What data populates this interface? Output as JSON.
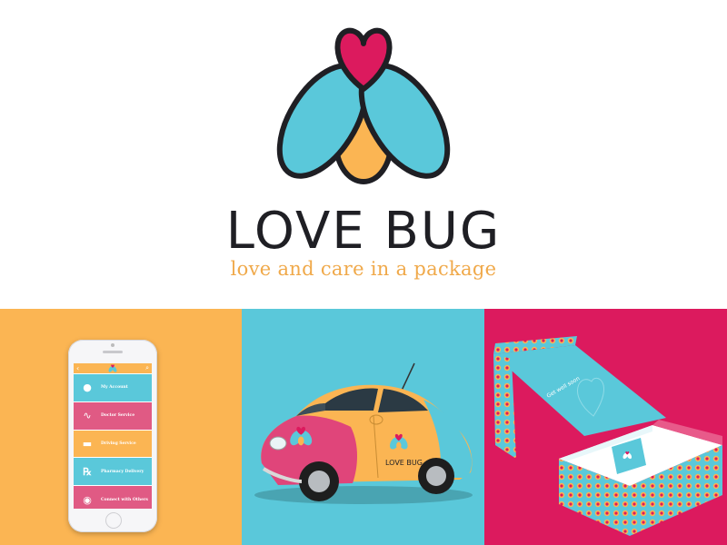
{
  "brand": {
    "name": "LOVE BUG",
    "tagline": "love and care in a package"
  },
  "colors": {
    "accent_yellow": "#fbb553",
    "accent_cyan": "#5ac8da",
    "accent_pink": "#dc1a5e",
    "text_dark": "#1f1f24",
    "tagline": "#f0a94a"
  },
  "phone_app": {
    "menu": [
      {
        "label": "My Account",
        "icon": "person-icon",
        "color": "#5ac8da"
      },
      {
        "label": "Doctor Service",
        "icon": "stethoscope-icon",
        "color": "#e05a84"
      },
      {
        "label": "Driving Service",
        "icon": "car-icon",
        "color": "#fbb553"
      },
      {
        "label": "Pharmacy Delivery",
        "icon": "rx-icon",
        "color": "#5ac8da"
      },
      {
        "label": "Connect with Others",
        "icon": "chat-icon",
        "color": "#e05a84"
      }
    ]
  },
  "car": {
    "door_text": "LOVE BUG"
  },
  "package": {
    "lid_text": "Get well soon"
  }
}
